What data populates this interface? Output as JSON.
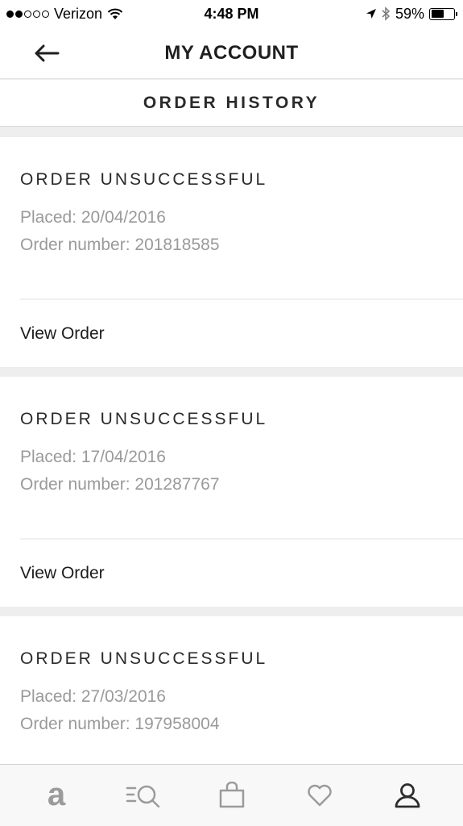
{
  "status_bar": {
    "carrier": "Verizon",
    "time": "4:48 PM",
    "battery": "59%",
    "battery_level": 0.59,
    "signal_bars_filled": 2,
    "signal_bars_total": 5
  },
  "header": {
    "title": "MY ACCOUNT",
    "back_icon": "arrow-left-icon"
  },
  "section": {
    "title": "ORDER HISTORY"
  },
  "orders": [
    {
      "status": "ORDER UNSUCCESSFUL",
      "placed": "Placed: 20/04/2016",
      "order_number": "Order number: 201818585",
      "action": "View Order"
    },
    {
      "status": "ORDER UNSUCCESSFUL",
      "placed": "Placed: 17/04/2016",
      "order_number": "Order number: 201287767",
      "action": "View Order"
    },
    {
      "status": "ORDER UNSUCCESSFUL",
      "placed": "Placed: 27/03/2016",
      "order_number": "Order number: 197958004",
      "action": ""
    }
  ],
  "tab_bar": {
    "items": [
      {
        "icon": "home-logo-icon"
      },
      {
        "icon": "search-icon"
      },
      {
        "icon": "bag-icon"
      },
      {
        "icon": "heart-icon"
      },
      {
        "icon": "profile-icon"
      }
    ],
    "active_color": "#2d2d2d",
    "inactive_color": "#9b9b9b"
  }
}
